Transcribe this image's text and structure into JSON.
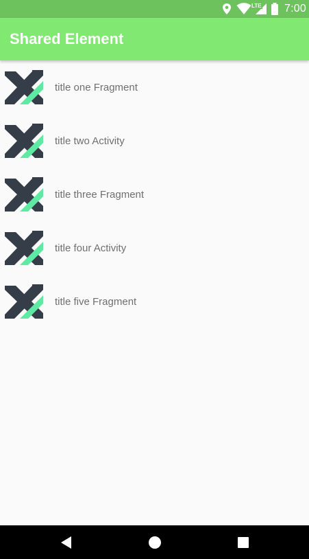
{
  "status_bar": {
    "network_label": "LTE",
    "time": "7:00",
    "icons": [
      "location-icon",
      "wifi-icon",
      "cell-signal-icon",
      "battery-icon"
    ]
  },
  "app_bar": {
    "title": "Shared Element"
  },
  "list": {
    "items": [
      {
        "title": "title one Fragment",
        "icon": "xamarin-logo-icon"
      },
      {
        "title": "title two Activity",
        "icon": "xamarin-logo-icon"
      },
      {
        "title": "title three Fragment",
        "icon": "xamarin-logo-icon"
      },
      {
        "title": "title four Activity",
        "icon": "xamarin-logo-icon"
      },
      {
        "title": "title five Fragment",
        "icon": "xamarin-logo-icon"
      }
    ]
  },
  "nav_bar": {
    "buttons": [
      "back-icon",
      "home-icon",
      "recents-icon"
    ]
  },
  "colors": {
    "status_bar": "#6dc25e",
    "app_bar": "#81e872",
    "background": "#fafafa",
    "item_text": "#6f6f6f",
    "logo_dark": "#353e48",
    "logo_accent": "#5eeaa2",
    "nav_bar": "#000000"
  }
}
